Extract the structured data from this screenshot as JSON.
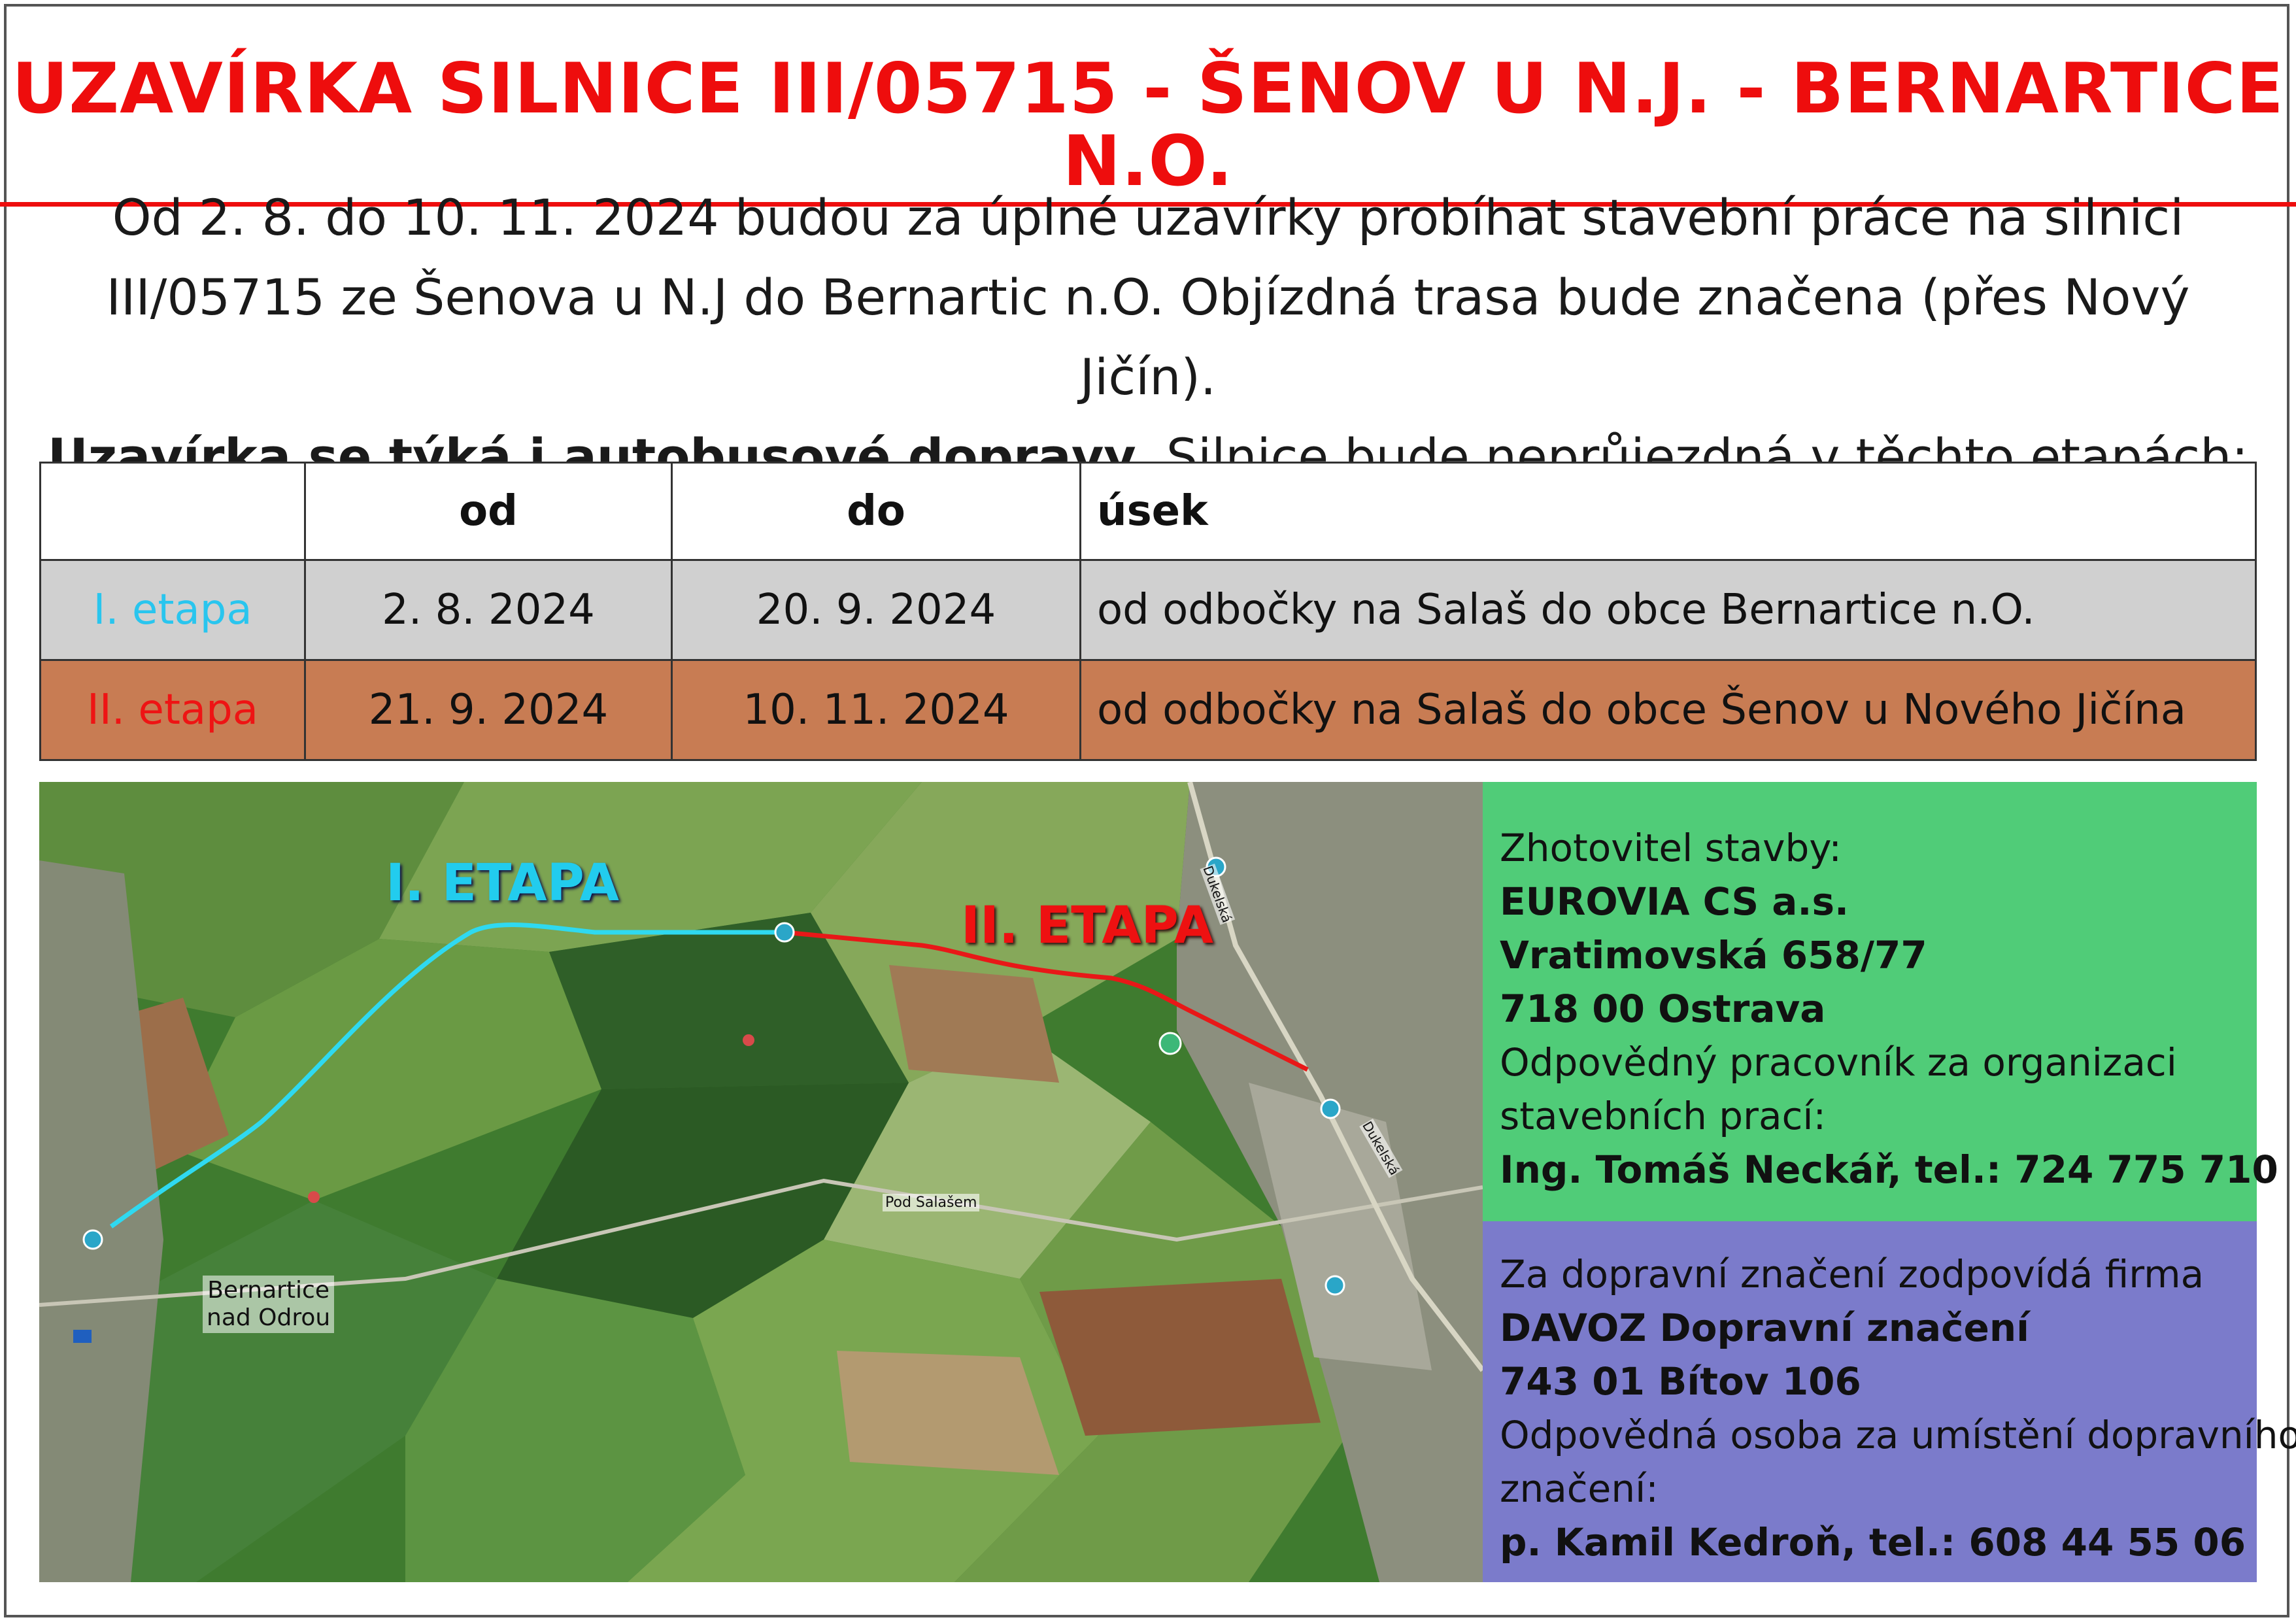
{
  "title": "UZAVÍRKA SILNICE III/05715 - ŠENOV U N.J. - BERNARTICE N.O.",
  "intro": {
    "line1": "Od 2. 8. do 10. 11. 2024 budou za úplné uzavírky probíhat stavební práce na silnici",
    "line2": "III/05715 ze Šenova u N.J do Bernartic n.O. Objízdná trasa bude značena (přes Nový Jičín).",
    "line3_bold": "Uzavírka se týká i autobusové dopravy.",
    "line3_rest": " Silnice bude neprůjezdná v těchto etapách:"
  },
  "table": {
    "headers": [
      "",
      "od",
      "do",
      "úsek"
    ],
    "rows": [
      {
        "stage": "I. etapa",
        "from": "2. 8. 2024",
        "to": "20. 9. 2024",
        "section": "od odbočky na Salaš do obce Bernartice n.O.",
        "stage_color": "#29c5ee",
        "row_color": "#d0d0d0"
      },
      {
        "stage": "II. etapa",
        "from": "21. 9. 2024",
        "to": "10. 11. 2024",
        "section": "od odbočky na Salaš do obce Šenov u Nového Jičína",
        "stage_color": "#ee1414",
        "row_color": "#c87c53"
      }
    ]
  },
  "map": {
    "etapa1_label": "I. ETAPA",
    "etapa2_label": "II. ETAPA",
    "town_line1": "Bernartice",
    "town_line2": "nad Odrou",
    "place_label": "Pod Salašem",
    "street1": "Dukelská",
    "street2": "Dukelská",
    "route1_color": "#2fd9f0",
    "route2_color": "#e81818"
  },
  "contractor": {
    "heading": "Zhotovitel stavby:",
    "company": "EUROVIA CS a.s.",
    "street": "Vratimovská 658/77",
    "city": "718 00  Ostrava",
    "responsible_line1": "Odpovědný pracovník za organizaci",
    "responsible_line2": "stavebních prací:",
    "person": "Ing. Tomáš Neckář, tel.: 724 775 710",
    "bg_color": "#50cc78"
  },
  "signage": {
    "heading": "Za dopravní značení zodpovídá firma",
    "company": "DAVOZ Dopravní značení",
    "address": "743 01 Bítov 106",
    "responsible_line1": "Odpovědná osoba za umístění dopravního",
    "responsible_line2": "značení:",
    "person": "p. Kamil Kedroň, tel.: 608 44 55 06",
    "bg_color": "#7b7bcb"
  }
}
